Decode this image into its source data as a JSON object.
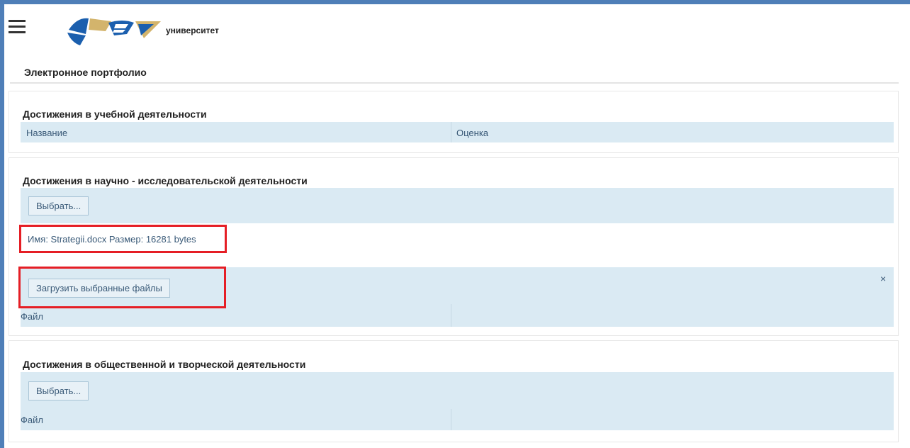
{
  "header": {
    "logo_text": "университет",
    "icons": [
      "menu-hamburger-icon",
      "university-logo"
    ]
  },
  "page_title": "Электронное портфолио",
  "sections": [
    {
      "title": "Достижения в учебной деятельности",
      "columns": [
        "Название",
        "Оценка"
      ]
    },
    {
      "title": "Достижения в научно - исследовательской деятельности",
      "select_label": "Выбрать...",
      "file_info": "Имя: Strategii.docx Размер: 16281 bytes",
      "upload_label": "Загрузить выбранные файлы",
      "close_label": "×",
      "column": "Файл"
    },
    {
      "title": "Достижения в общественной и творческой деятельности",
      "select_label": "Выбрать...",
      "column": "Файл"
    }
  ],
  "colors": {
    "frame": "#4f7fb8",
    "band": "#daeaf3",
    "highlight": "#e51e25",
    "text_link": "#3a5a78"
  }
}
